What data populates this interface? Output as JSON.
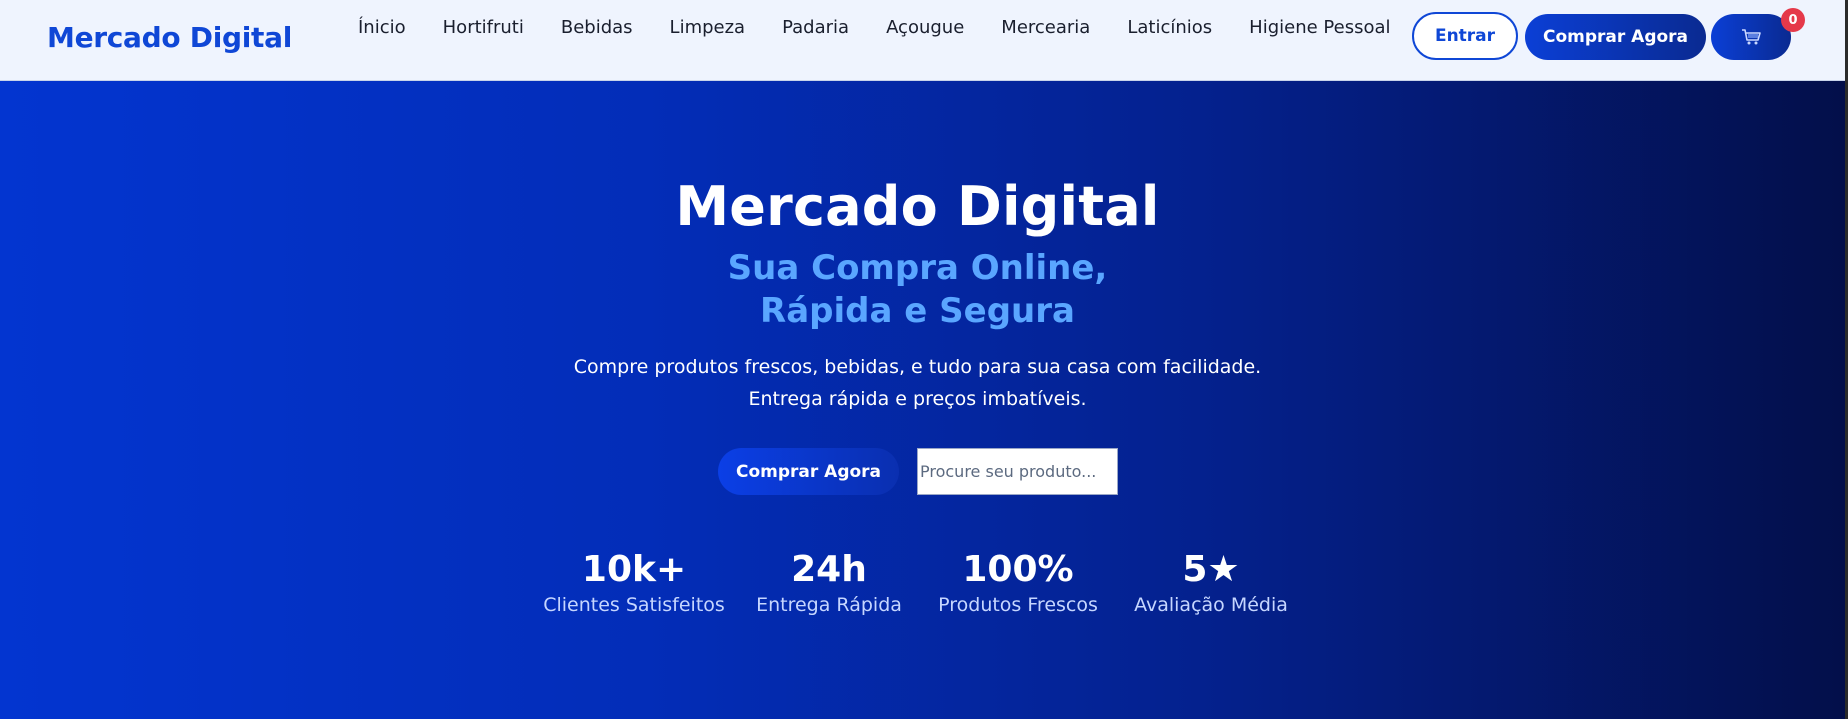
{
  "header": {
    "brand": "Mercado Digital",
    "nav": [
      "Ínicio",
      "Hortifruti",
      "Bebidas",
      "Limpeza",
      "Padaria",
      "Açougue",
      "Mercearia",
      "Laticínios",
      "Higiene Pessoal"
    ],
    "login_label": "Entrar",
    "buy_label": "Comprar Agora",
    "cart_icon": "shopping-cart-icon",
    "cart_count": "0"
  },
  "hero": {
    "title": "Mercado Digital",
    "subtitle_line1": "Sua Compra Online,",
    "subtitle_line2": "Rápida e Segura",
    "description_line1": "Compre produtos frescos, bebidas, e tudo para sua casa com facilidade.",
    "description_line2": "Entrega rápida e preços imbatíveis.",
    "cta_label": "Comprar Agora",
    "search_placeholder": "Procure seu produto..."
  },
  "stats": [
    {
      "value": "10k+",
      "label": "Clientes Satisfeitos"
    },
    {
      "value": "24h",
      "label": "Entrega Rápida"
    },
    {
      "value": "100%",
      "label": "Produtos Frescos"
    },
    {
      "value": "5★",
      "label": "Avaliação Média"
    }
  ],
  "colors": {
    "brand": "#0f47d6",
    "subtitle": "#5aa6ff",
    "badge": "#e5394a"
  }
}
